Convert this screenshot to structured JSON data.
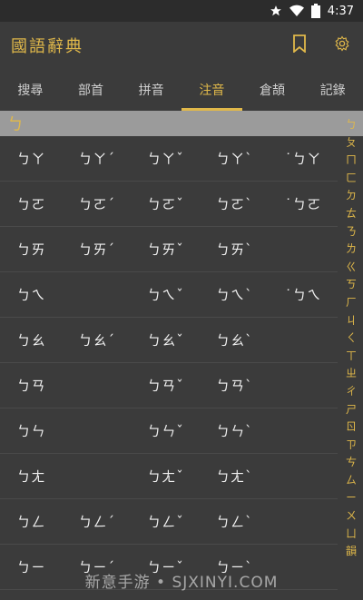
{
  "status": {
    "time": "4:37"
  },
  "app": {
    "title": "國語辭典"
  },
  "tabs": [
    {
      "label": "搜尋"
    },
    {
      "label": "部首"
    },
    {
      "label": "拼音"
    },
    {
      "label": "注音"
    },
    {
      "label": "倉頡"
    },
    {
      "label": "記錄"
    }
  ],
  "section": {
    "label": "ㄅ"
  },
  "rows": [
    [
      "ㄅㄚ",
      "ㄅㄚˊ",
      "ㄅㄚˇ",
      "ㄅㄚˋ",
      "˙ㄅㄚ"
    ],
    [
      "ㄅㄛ",
      "ㄅㄛˊ",
      "ㄅㄛˇ",
      "ㄅㄛˋ",
      "˙ㄅㄛ"
    ],
    [
      "ㄅㄞ",
      "ㄅㄞˊ",
      "ㄅㄞˇ",
      "ㄅㄞˋ",
      ""
    ],
    [
      "ㄅㄟ",
      "",
      "ㄅㄟˇ",
      "ㄅㄟˋ",
      "˙ㄅㄟ"
    ],
    [
      "ㄅㄠ",
      "ㄅㄠˊ",
      "ㄅㄠˇ",
      "ㄅㄠˋ",
      ""
    ],
    [
      "ㄅㄢ",
      "",
      "ㄅㄢˇ",
      "ㄅㄢˋ",
      ""
    ],
    [
      "ㄅㄣ",
      "",
      "ㄅㄣˇ",
      "ㄅㄣˋ",
      ""
    ],
    [
      "ㄅㄤ",
      "",
      "ㄅㄤˇ",
      "ㄅㄤˋ",
      ""
    ],
    [
      "ㄅㄥ",
      "ㄅㄥˊ",
      "ㄅㄥˇ",
      "ㄅㄥˋ",
      ""
    ],
    [
      "ㄅㄧ",
      "ㄅㄧˊ",
      "ㄅㄧˇ",
      "ㄅㄧˋ",
      ""
    ]
  ],
  "index": [
    "ㄅ",
    "ㄆ",
    "ㄇ",
    "ㄈ",
    "ㄉ",
    "ㄊ",
    "ㄋ",
    "ㄌ",
    "ㄍ",
    "ㄎ",
    "ㄏ",
    "ㄐ",
    "ㄑ",
    "ㄒ",
    "ㄓ",
    "ㄔ",
    "ㄕ",
    "ㄖ",
    "ㄗ",
    "ㄘ",
    "ㄙ",
    "ㄧ",
    "ㄨ",
    "ㄩ",
    "韻"
  ],
  "watermark": "新意手游 • SJXINYI.COM",
  "colors": {
    "accent": "#e0b84a",
    "background": "#3b3b3b",
    "header_row": "#9b9b9b"
  }
}
